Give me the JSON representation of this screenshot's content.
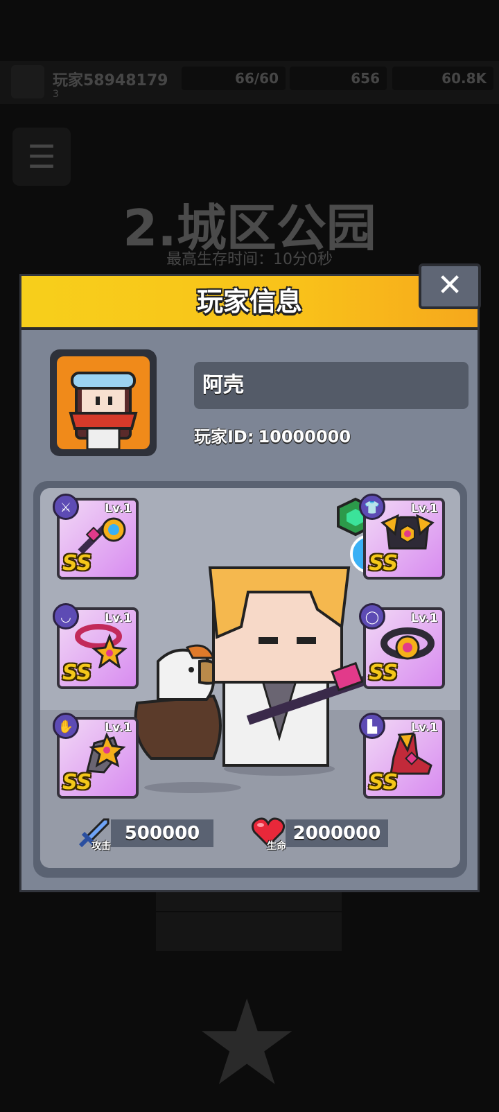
{
  "background": {
    "player_name": "玩家58948179",
    "player_level": "3",
    "stat1": "66/60",
    "stat2": "656",
    "stat3": "60.8K",
    "stage_title": "2.城区公园",
    "survival_time": "最高生存时间：10分0秒"
  },
  "modal": {
    "title": "玩家信息",
    "close_label": "✕",
    "player_name": "阿壳",
    "player_id_label": "玩家ID:",
    "player_id_value": "10000000",
    "attack_label": "攻击",
    "attack_value": "500000",
    "hp_label": "生命",
    "hp_value": "2000000"
  },
  "equipment": [
    {
      "slot": "weapon",
      "level": "Lv.1",
      "rank": "SS"
    },
    {
      "slot": "armor",
      "level": "Lv.1",
      "rank": "SS"
    },
    {
      "slot": "necklace",
      "level": "Lv.1",
      "rank": "SS"
    },
    {
      "slot": "belt",
      "level": "Lv.1",
      "rank": "SS"
    },
    {
      "slot": "gloves",
      "level": "Lv.1",
      "rank": "SS"
    },
    {
      "slot": "boots",
      "level": "Lv.1",
      "rank": "SS"
    }
  ],
  "colors": {
    "header": "#f9c21a",
    "panel": "#7d8595",
    "slot_bg": "#d88cf0",
    "rank": "#f4c71a"
  }
}
